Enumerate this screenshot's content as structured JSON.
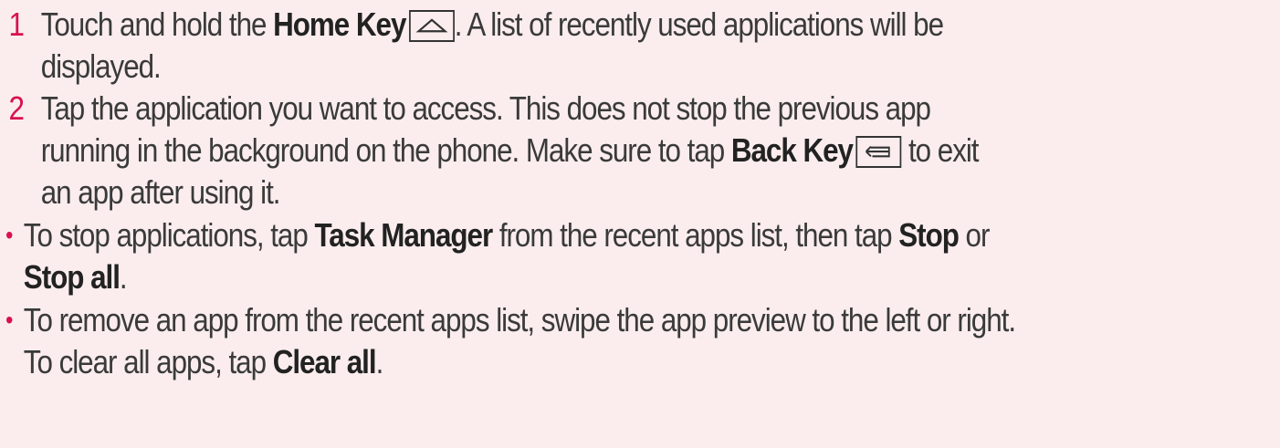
{
  "steps": [
    {
      "number": "1",
      "t1": "Touch and hold the ",
      "b1": "Home Key",
      "icon": "home-key-icon",
      "t2": ". A list of recently used applications will be",
      "t3": "displayed."
    },
    {
      "number": "2",
      "t1": "Tap the application you want to access. This does not stop the previous app",
      "t2": "running in the background on the phone. Make sure to tap ",
      "b1": "Back Key",
      "icon": "back-key-icon",
      "t3": " to exit",
      "t4": "an app after using it."
    }
  ],
  "bullets": [
    {
      "marker": "•",
      "t1": "To stop applications, tap ",
      "b1": "Task Manager",
      "t2": " from the recent apps list, then tap ",
      "b2": "Stop",
      "t3": " or",
      "b3": "Stop all",
      "t4": "."
    },
    {
      "marker": "•",
      "t1": "To remove an app from the recent apps list, swipe the app preview to the left or right.",
      "t2": "To clear all apps, tap ",
      "b1": "Clear all",
      "t3": "."
    }
  ],
  "colors": {
    "accent": "#d8114f",
    "background": "#fbeded",
    "text": "#3a3a3a"
  }
}
